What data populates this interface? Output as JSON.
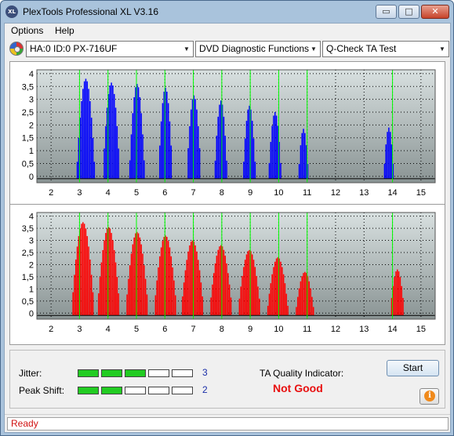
{
  "window": {
    "title": "PlexTools Professional XL V3.16",
    "icon_text": "XL",
    "minimize_glyph": "▭",
    "maximize_glyph": "□",
    "close_glyph": "✕"
  },
  "menu": {
    "items": [
      "Options",
      "Help"
    ]
  },
  "toolbar": {
    "drive": "HA:0 ID:0  PX-716UF",
    "function": "DVD Diagnostic Functions",
    "test": "Q-Check TA Test",
    "dropdown_glyph": "▼"
  },
  "chart_data": [
    {
      "type": "histogram",
      "panel": "top",
      "bar_color": "#0000ff",
      "x_ticks": [
        2,
        3,
        4,
        5,
        6,
        7,
        8,
        9,
        10,
        11,
        12,
        13,
        14,
        15
      ],
      "y_ticks": [
        "0",
        "0,5",
        "1",
        "1,5",
        "2",
        "2,5",
        "3",
        "3,5",
        "4"
      ],
      "xlim": [
        1.5,
        15.5
      ],
      "ylim": [
        -0.25,
        4.15
      ],
      "marker_lines_x": [
        3,
        4,
        5,
        6,
        7,
        8,
        9,
        10,
        11,
        14
      ],
      "peaks": [
        {
          "center": 3.2,
          "height": 3.8,
          "width": 0.65
        },
        {
          "center": 4.1,
          "height": 3.65,
          "width": 0.6
        },
        {
          "center": 5.0,
          "height": 3.6,
          "width": 0.55
        },
        {
          "center": 6.0,
          "height": 3.45,
          "width": 0.5
        },
        {
          "center": 7.0,
          "height": 3.15,
          "width": 0.5
        },
        {
          "center": 7.95,
          "height": 2.95,
          "width": 0.45
        },
        {
          "center": 8.95,
          "height": 2.75,
          "width": 0.45
        },
        {
          "center": 9.85,
          "height": 2.5,
          "width": 0.45
        },
        {
          "center": 10.85,
          "height": 1.85,
          "width": 0.35
        },
        {
          "center": 13.85,
          "height": 1.9,
          "width": 0.35
        }
      ]
    },
    {
      "type": "histogram",
      "panel": "bottom",
      "bar_color": "#ff0000",
      "x_ticks": [
        2,
        3,
        4,
        5,
        6,
        7,
        8,
        9,
        10,
        11,
        12,
        13,
        14,
        15
      ],
      "y_ticks": [
        "0",
        "0,5",
        "1",
        "1,5",
        "2",
        "2,5",
        "3",
        "3,5",
        "4"
      ],
      "xlim": [
        1.5,
        15.5
      ],
      "ylim": [
        -0.25,
        4.15
      ],
      "marker_lines_x": [
        3,
        4,
        5,
        6,
        7,
        8,
        9,
        10,
        11,
        14
      ],
      "peaks": [
        {
          "center": 3.1,
          "height": 3.75,
          "width": 0.8
        },
        {
          "center": 4.0,
          "height": 3.55,
          "width": 0.8
        },
        {
          "center": 5.0,
          "height": 3.35,
          "width": 0.8
        },
        {
          "center": 6.0,
          "height": 3.2,
          "width": 0.8
        },
        {
          "center": 6.95,
          "height": 3.0,
          "width": 0.8
        },
        {
          "center": 7.95,
          "height": 2.8,
          "width": 0.8
        },
        {
          "center": 8.95,
          "height": 2.6,
          "width": 0.8
        },
        {
          "center": 9.95,
          "height": 2.3,
          "width": 0.75
        },
        {
          "center": 10.9,
          "height": 1.7,
          "width": 0.65
        },
        {
          "center": 14.15,
          "height": 1.8,
          "width": 0.5
        }
      ]
    }
  ],
  "results": {
    "jitter_label": "Jitter:",
    "jitter_value": "3",
    "jitter_segments": 3,
    "peak_shift_label": "Peak Shift:",
    "peak_shift_value": "2",
    "peak_shift_segments": 2,
    "segments_total": 5,
    "ta_label": "TA Quality Indicator:",
    "ta_value": "Not Good",
    "start_label": "Start",
    "info_glyph": "i"
  },
  "status": {
    "text": "Ready"
  },
  "colors": {
    "plot_background_top": "#d8e0e0",
    "plot_background_bottom": "#8a9494",
    "gridline": "#000000",
    "marker_line": "#00ff00",
    "segment_on": "#22cc22",
    "status_text": "#d01010",
    "ta_value": "#e81010"
  }
}
